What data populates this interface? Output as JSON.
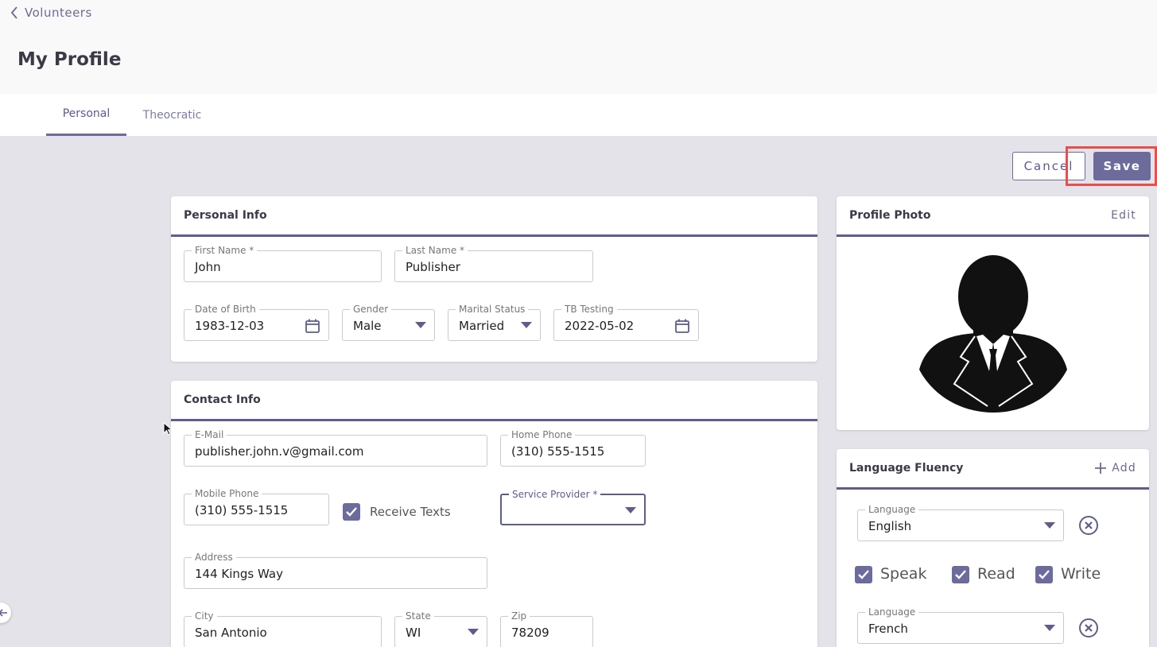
{
  "header": {
    "back_label": "Volunteers",
    "title": "My Profile"
  },
  "tabs": [
    {
      "label": "Personal",
      "active": true
    },
    {
      "label": "Theocratic",
      "active": false
    }
  ],
  "actions": {
    "cancel_label": "Cancel",
    "save_label": "Save"
  },
  "personal_info": {
    "title": "Personal Info",
    "first_name": {
      "label": "First Name *",
      "value": "John"
    },
    "last_name": {
      "label": "Last Name *",
      "value": "Publisher"
    },
    "dob": {
      "label": "Date of Birth",
      "value": "1983-12-03"
    },
    "gender": {
      "label": "Gender",
      "value": "Male"
    },
    "marital": {
      "label": "Marital Status",
      "value": "Married"
    },
    "tb": {
      "label": "TB Testing",
      "value": "2022-05-02"
    }
  },
  "contact_info": {
    "title": "Contact Info",
    "email": {
      "label": "E-Mail",
      "value": "publisher.john.v@gmail.com"
    },
    "home_phone": {
      "label": "Home Phone",
      "value": "(310) 555-1515"
    },
    "mobile_phone": {
      "label": "Mobile Phone",
      "value": "(310) 555-1515"
    },
    "receive_texts": {
      "label": "Receive Texts",
      "checked": true
    },
    "service_provider": {
      "label": "Service Provider *",
      "value": ""
    },
    "address": {
      "label": "Address",
      "value": "144 Kings Way"
    },
    "city": {
      "label": "City",
      "value": "San Antonio"
    },
    "state": {
      "label": "State",
      "value": "WI"
    },
    "zip": {
      "label": "Zip",
      "value": "78209"
    }
  },
  "profile_photo": {
    "title": "Profile Photo",
    "edit_label": "Edit"
  },
  "language_fluency": {
    "title": "Language Fluency",
    "add_label": "Add",
    "entries": [
      {
        "label": "Language",
        "value": "English",
        "speak": "Speak",
        "read": "Read",
        "write": "Write"
      },
      {
        "label": "Language",
        "value": "French"
      }
    ]
  },
  "colors": {
    "accent": "#6c6b9c",
    "highlight": "#ea4e48",
    "background": "#e4e3ea"
  }
}
